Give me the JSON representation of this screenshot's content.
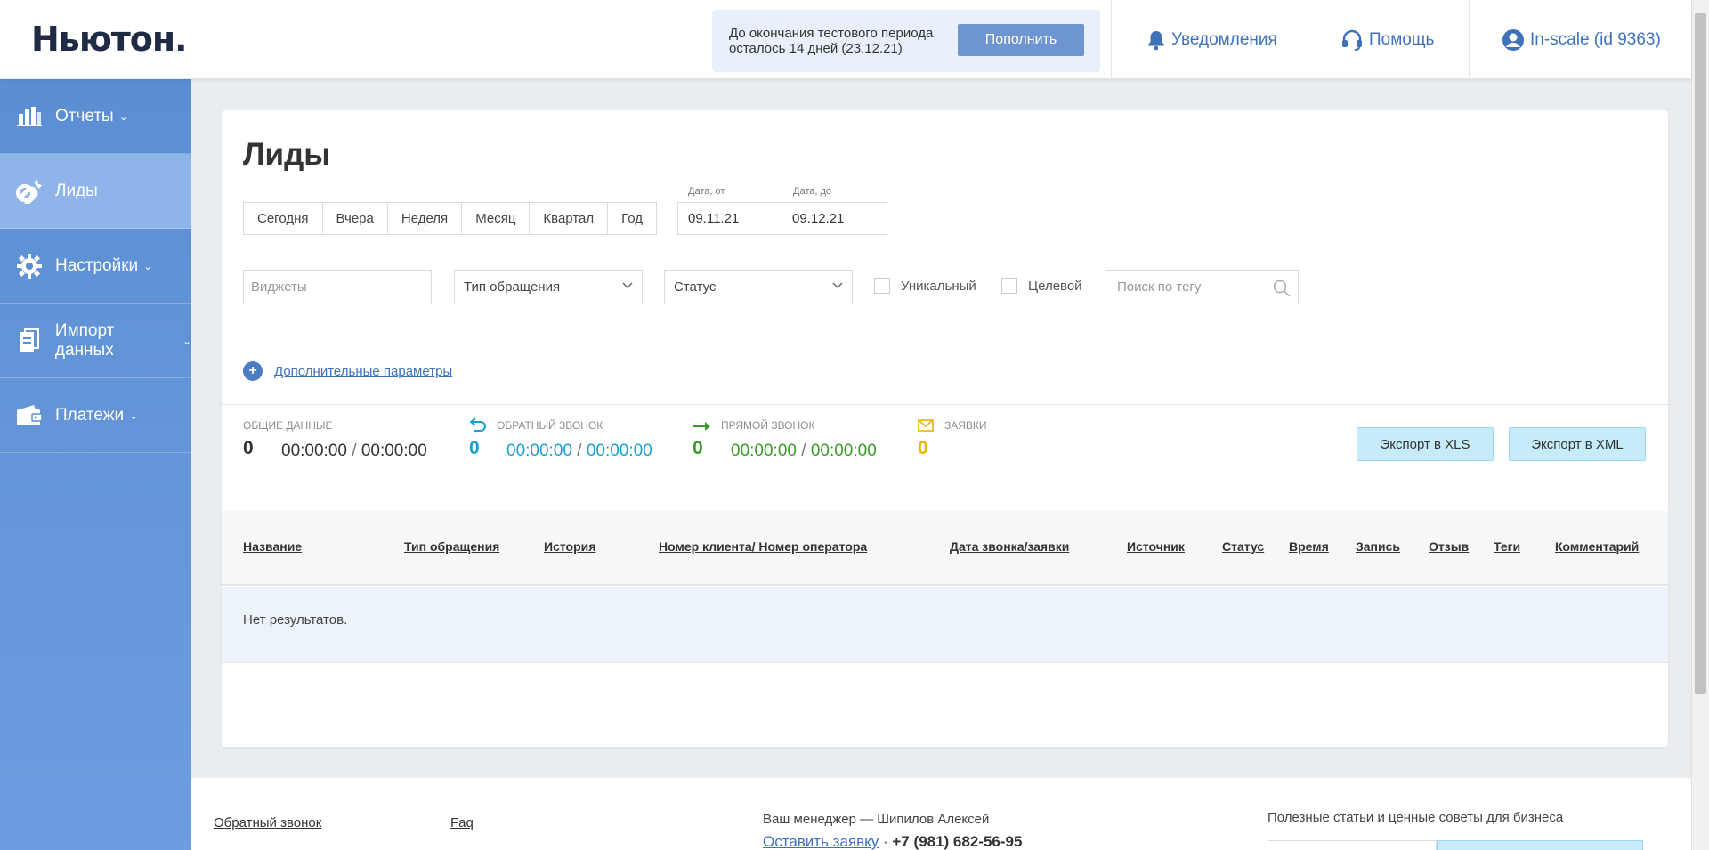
{
  "header": {
    "logo": "Ньютон.",
    "trial_text": "До окончания тестового периода осталось 14 дней (23.12.21)",
    "topup_label": "Пополнить",
    "notifications_label": "Уведомления",
    "help_label": "Помощь",
    "account_label": "In-scale (id 9363)"
  },
  "sidebar": {
    "items": [
      {
        "label": "Отчеты",
        "icon": "bar-chart-icon"
      },
      {
        "label": "Лиды",
        "icon": "magnet-icon"
      },
      {
        "label": "Настройки",
        "icon": "gear-icon"
      },
      {
        "label": "Импорт данных",
        "icon": "clipboard-icon"
      },
      {
        "label": "Платежи",
        "icon": "wallet-icon"
      }
    ]
  },
  "main": {
    "title": "Лиды",
    "periods": [
      "Сегодня",
      "Вчера",
      "Неделя",
      "Месяц",
      "Квартал",
      "Год"
    ],
    "date_from_label": "Дата, от",
    "date_to_label": "Дата, до",
    "date_from": "09.11.21",
    "date_to": "09.12.21",
    "widgets_placeholder": "Виджеты",
    "type_select": "Тип обращения",
    "status_select": "Статус",
    "unique_label": "Уникальный",
    "target_label": "Целевой",
    "tag_search_placeholder": "Поиск по тегу",
    "more_params": "Дополнительные параметры"
  },
  "stats": {
    "total": {
      "label": "Общие данные",
      "count": "0",
      "time1": "00:00:00",
      "sep": "/",
      "time2": "00:00:00"
    },
    "callback": {
      "label": "Обратный звонок",
      "count": "0",
      "time1": "00:00:00",
      "sep": "/",
      "time2": "00:00:00"
    },
    "direct": {
      "label": "Прямой звонок",
      "count": "0",
      "time1": "00:00:00",
      "sep": "/",
      "time2": "00:00:00"
    },
    "requests": {
      "label": "Заявки",
      "count": "0"
    }
  },
  "export": {
    "xls": "Экспорт в XLS",
    "xml": "Экспорт в XML"
  },
  "table": {
    "columns": [
      "Название",
      "Тип обращения",
      "История",
      "Номер клиента/ Номер оператора",
      "Дата звонка/заявки",
      "Источник",
      "Статус",
      "Время",
      "Запись",
      "Отзыв",
      "Теги",
      "Комментарий"
    ],
    "empty_text": "Нет результатов."
  },
  "footer": {
    "callback_link": "Обратный звонок",
    "faq_link": "Faq",
    "manager_text": "Ваш менеджер — Шипилов Алексей",
    "request_link": "Оставить заявку",
    "dot": "·",
    "phone": "+7 (981) 682-56-95",
    "articles_text": "Полезные статьи и ценные советы для бизнеса"
  },
  "colors": {
    "accent": "#3f72b8",
    "callback": "#1a9fd4",
    "direct": "#3a9a2a",
    "requests": "#e8b400"
  }
}
